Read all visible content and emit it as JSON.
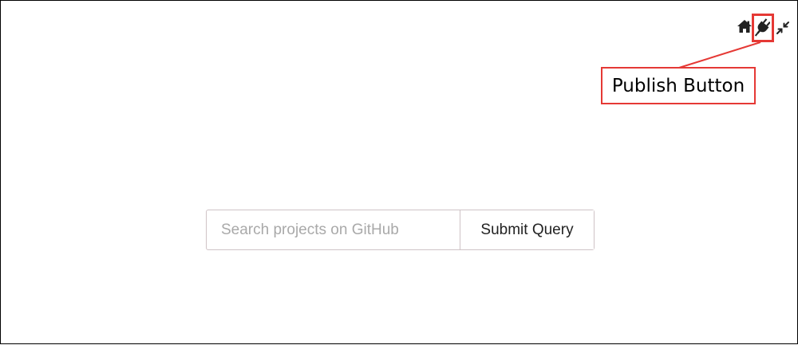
{
  "toolbar": {
    "icons": [
      "home-icon",
      "plug-icon",
      "collapse-icon"
    ]
  },
  "annotation": {
    "label": "Publish Button",
    "color": "#e53935"
  },
  "search": {
    "placeholder": "Search projects on GitHub",
    "value": "",
    "submit_label": "Submit Query"
  }
}
